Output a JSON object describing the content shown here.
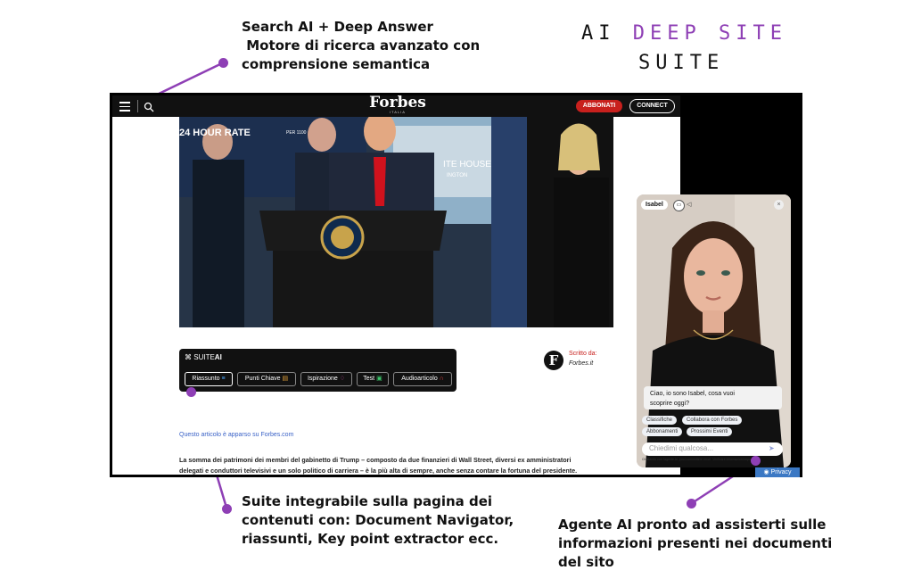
{
  "brand": {
    "line1_prefix": "AI ",
    "line1_accent": "DEEP SITE",
    "line2": "SUITE",
    "accent_color": "#8e3fb5"
  },
  "callouts": {
    "search": [
      "Search AI + Deep Answer",
      " Motore di ricerca avanzato con",
      "comprensione semantica"
    ],
    "suite": [
      "Suite integrabile sulla pagina dei",
      "contenuti con: Document Navigator,",
      "riassunti, Key point extractor ecc."
    ],
    "agent": [
      "Agente AI pronto ad assisterti sulle",
      "informazioni presenti nei documenti",
      "del sito"
    ]
  },
  "site": {
    "logo": "Forbes",
    "logo_sub": "ITALIA",
    "subscribe_label": "ABBONATI",
    "connect_label": "CONNECT",
    "hero_banner_text": "24 HOUR RATE",
    "hero_banner_small": "PER 1100",
    "hero_sign": "ITE HOUSE",
    "hero_sign2": "INGTON"
  },
  "suite": {
    "title_prefix": "SUITE",
    "title_bold": "AI",
    "chips": [
      "Riassunto",
      "Punti Chiave",
      "Ispirazione",
      "Test",
      "Audioarticolo"
    ]
  },
  "author": {
    "label": "Scritto da:",
    "name": "Forbes.it",
    "logo_letter": "F"
  },
  "article": {
    "source_link": "Questo articolo è apparso su Forbes.com",
    "body": [
      "La somma dei patrimoni dei membri del gabinetto di Trump – composto da due finanzieri di Wall Street, diversi ex amministratori",
      "delegati e conduttori televisivi e un solo politico di carriera – è la più alta di sempre, anche senza contare la fortuna del presidente."
    ]
  },
  "agent": {
    "name": "Isabel",
    "greeting": [
      "Ciao, io sono Isabel, cosa vuoi",
      "scoprire oggi?"
    ],
    "quick_replies": [
      "Classifiche",
      "Collabora con Forbes",
      "Abbonamenti",
      "Prossimi Eventi"
    ],
    "input_placeholder": "Chiedimi qualcosa...",
    "disclaimer": "Chattando con l'agente AI, puoi commettere errori. Verificare informazioni importanti.",
    "privacy_label": "Privacy"
  }
}
